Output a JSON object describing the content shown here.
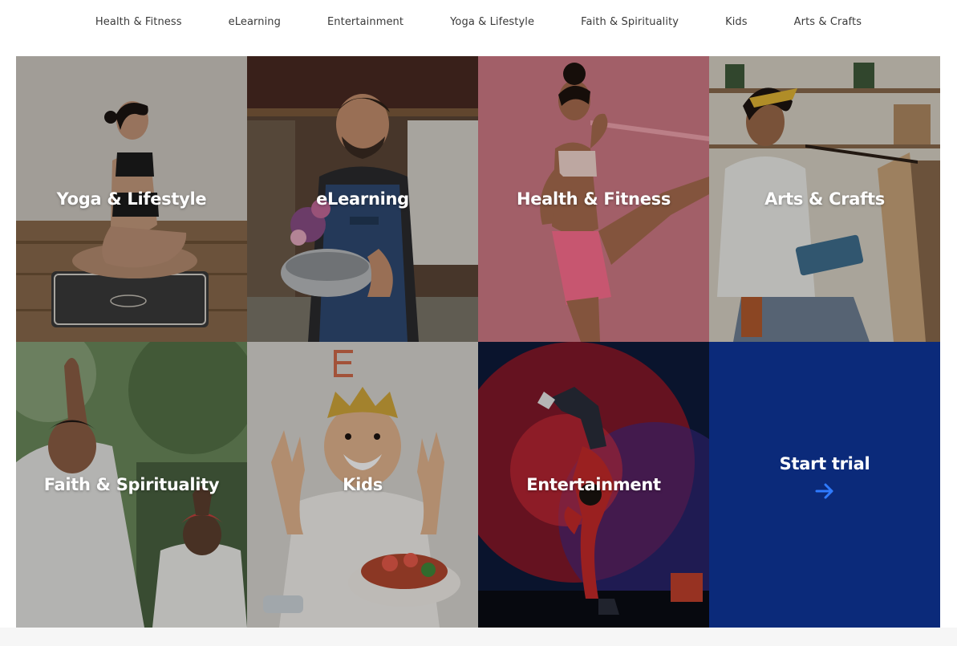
{
  "nav": {
    "items": [
      {
        "label": "Health & Fitness"
      },
      {
        "label": "eLearning"
      },
      {
        "label": "Entertainment"
      },
      {
        "label": "Yoga & Lifestyle"
      },
      {
        "label": "Faith & Spirituality"
      },
      {
        "label": "Kids"
      },
      {
        "label": "Arts & Crafts"
      }
    ]
  },
  "tiles": [
    {
      "label": "Yoga & Lifestyle"
    },
    {
      "label": "eLearning"
    },
    {
      "label": "Health & Fitness"
    },
    {
      "label": "Arts & Crafts"
    },
    {
      "label": "Faith & Spirituality"
    },
    {
      "label": "Kids"
    },
    {
      "label": "Entertainment"
    }
  ],
  "cta": {
    "label": "Start trial",
    "icon": "arrow-right-icon",
    "background": "#0b2a7a",
    "arrow_color": "#2f7bff"
  }
}
